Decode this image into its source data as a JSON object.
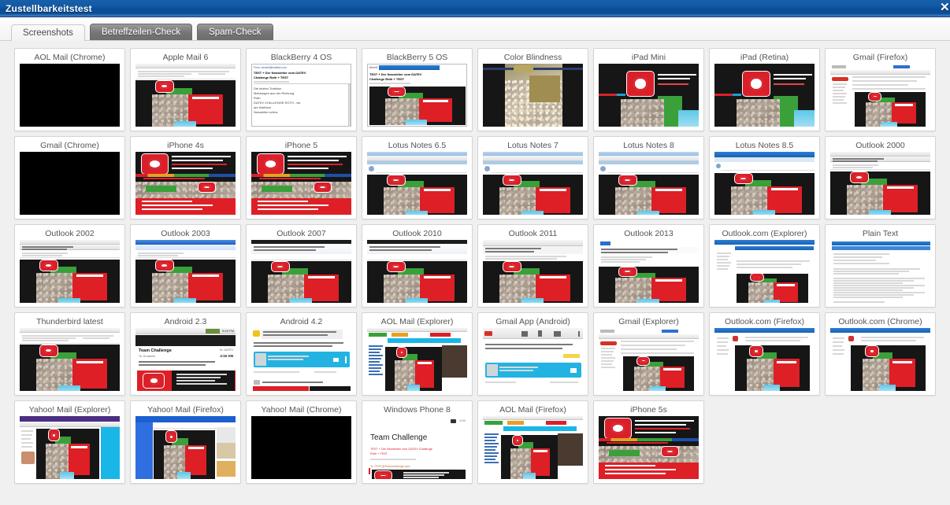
{
  "window": {
    "title": "Zustellbarkeitstest",
    "close_label": "✕",
    "titlebar_color": "#0f5aa5"
  },
  "tabs": [
    {
      "label": "Screenshots",
      "active": true
    },
    {
      "label": "Betreffzeilen-Check",
      "active": false
    },
    {
      "label": "Spam-Check",
      "active": false
    }
  ],
  "grid": {
    "columns": 8,
    "rows": 5,
    "total_cards": 38,
    "cards": [
      {
        "title": "AOL Mail (Chrome)",
        "art": "black"
      },
      {
        "title": "Apple Mail 6",
        "art": "desktop-mail"
      },
      {
        "title": "BlackBerry 4 OS",
        "art": "bb4"
      },
      {
        "title": "BlackBerry 5 OS",
        "art": "bb5"
      },
      {
        "title": "Color Blindness",
        "art": "colorblind"
      },
      {
        "title": "iPad Mini",
        "art": "ipad"
      },
      {
        "title": "iPad (Retina)",
        "art": "ipad"
      },
      {
        "title": "Gmail (Firefox)",
        "art": "gmail-web"
      },
      {
        "title": "Gmail (Chrome)",
        "art": "black"
      },
      {
        "title": "iPhone 4s",
        "art": "iphone"
      },
      {
        "title": "iPhone 5",
        "art": "iphone"
      },
      {
        "title": "Lotus Notes 6.5",
        "art": "lotus"
      },
      {
        "title": "Lotus Notes 7",
        "art": "lotus"
      },
      {
        "title": "Lotus Notes 8",
        "art": "lotus"
      },
      {
        "title": "Lotus Notes 8.5",
        "art": "lotus85"
      },
      {
        "title": "Outlook 2000",
        "art": "outlook-classic"
      },
      {
        "title": "Outlook 2002",
        "art": "outlook-classic"
      },
      {
        "title": "Outlook 2003",
        "art": "outlook2003"
      },
      {
        "title": "Outlook 2007",
        "art": "outlook-ribbon"
      },
      {
        "title": "Outlook 2010",
        "art": "outlook-ribbon"
      },
      {
        "title": "Outlook 2011",
        "art": "outlook2011"
      },
      {
        "title": "Outlook 2013",
        "art": "outlook2013"
      },
      {
        "title": "Outlook.com (Explorer)",
        "art": "outlookcom"
      },
      {
        "title": "Plain Text",
        "art": "plaintext"
      },
      {
        "title": "Thunderbird latest",
        "art": "desktop-mail"
      },
      {
        "title": "Android 2.3",
        "art": "android23"
      },
      {
        "title": "Android 4.2",
        "art": "android42"
      },
      {
        "title": "AOL Mail (Explorer)",
        "art": "aol-web"
      },
      {
        "title": "Gmail App (Android)",
        "art": "gmailapp"
      },
      {
        "title": "Gmail (Explorer)",
        "art": "gmail-web"
      },
      {
        "title": "Outlook.com (Firefox)",
        "art": "outlookcom2"
      },
      {
        "title": "Outlook.com (Chrome)",
        "art": "outlookcom2"
      },
      {
        "title": "Yahoo! Mail (Explorer)",
        "art": "yahoo-ie"
      },
      {
        "title": "Yahoo! Mail (Firefox)",
        "art": "yahoo-ff"
      },
      {
        "title": "Yahoo! Mail (Chrome)",
        "art": "black"
      },
      {
        "title": "Windows Phone 8",
        "art": "wp8"
      },
      {
        "title": "AOL Mail (Firefox)",
        "art": "aol-web"
      },
      {
        "title": "iPhone 5s",
        "art": "iphone"
      }
    ]
  },
  "thumbnail_text": {
    "bb4_from": "From: sendet@mailbot.com",
    "bb4_subject_1": "TEST + Der Newsletter vom DATEV",
    "bb4_subject_2": "Challenge Roth + TEST",
    "bb4_body_1": "Die letzten Triathlon",
    "bb4_body_2": "Meldungen aus der Richtung",
    "bb4_body_3": "Roth.",
    "bb4_body_4": "DATEV CHALLENGE ROTH - we",
    "bb4_body_5": "are triathlon!",
    "bb4_body_6": "Newsletter online",
    "bb5_label": "Betreff:",
    "bb5_subject_1": "TEST + Der Newsletter vom DATEV",
    "bb5_subject_2": "Challenge Roth + TEST",
    "android23_title": "Team Challenge",
    "android23_time": "4:15 AM",
    "wp8_title": "Team Challenge",
    "wp8_sub_1": "TEST + Der Newsletter vom DATEV Challenge",
    "wp8_sub_2": "Roth + TEST",
    "wp8_to": "To: TEST@Teamchallenge.com"
  }
}
